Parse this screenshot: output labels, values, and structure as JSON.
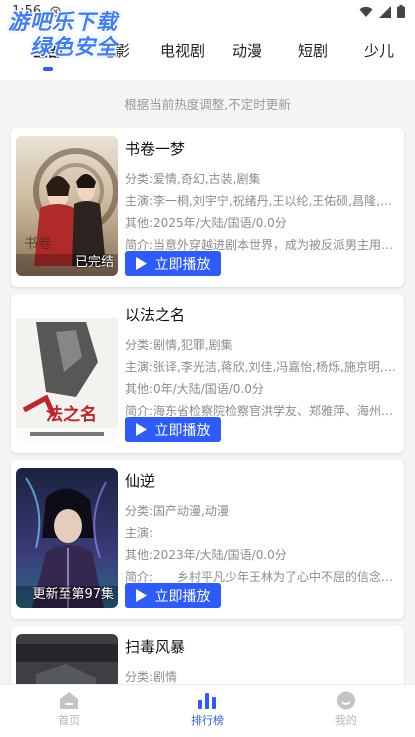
{
  "status": {
    "time": "1:56"
  },
  "watermark": {
    "line1": "游吧乐下载",
    "line2": "绿色安全"
  },
  "tabs": [
    {
      "label": "全部"
    },
    {
      "label": "电影"
    },
    {
      "label": "电视剧"
    },
    {
      "label": "动漫"
    },
    {
      "label": "短剧"
    },
    {
      "label": "少儿"
    }
  ],
  "notice": "根据当前热度调整,不定时更新",
  "play_label": "立即播放",
  "items": [
    {
      "title": "书卷一梦",
      "category": "分类:爱情,奇幻,古装,剧集",
      "cast": "主演:李一桐,刘宇宁,祝绪丹,王以纶,王佑硕,昌隆,吕...",
      "other": "其他:2025年/大陆/国语/0.0分",
      "summary": "简介:当意外穿越进剧本世界，成为被反派男主用完...",
      "badge": "已完结"
    },
    {
      "title": "以法之名",
      "category": "分类:剧情,犯罪,剧集",
      "cast": "主演:张译,李光洁,蒋欣,刘佳,冯嘉怡,杨烁,施京明,董...",
      "other": "其他:0年/大陆/国语/0.0分",
      "summary": "简介:海东省检察院检察官洪学友、郑雅萍、海州市...",
      "badge": ""
    },
    {
      "title": "仙逆",
      "category": "分类:国产动漫,动漫",
      "cast": "主演:",
      "other": "其他:2023年/大陆/国语/0.0分",
      "summary": "简介:　　乡村平凡少年王林为了心中不屈的信念踏...",
      "badge": "更新至第97集"
    },
    {
      "title": "扫毒风暴",
      "category": "分类:剧情"
    }
  ],
  "nav": [
    {
      "label": "首页",
      "icon": "home-icon"
    },
    {
      "label": "排行榜",
      "icon": "bar-chart-icon"
    },
    {
      "label": "我的",
      "icon": "profile-icon"
    }
  ],
  "colors": {
    "accent": "#2d5bff",
    "background": "#f5f5f5"
  }
}
